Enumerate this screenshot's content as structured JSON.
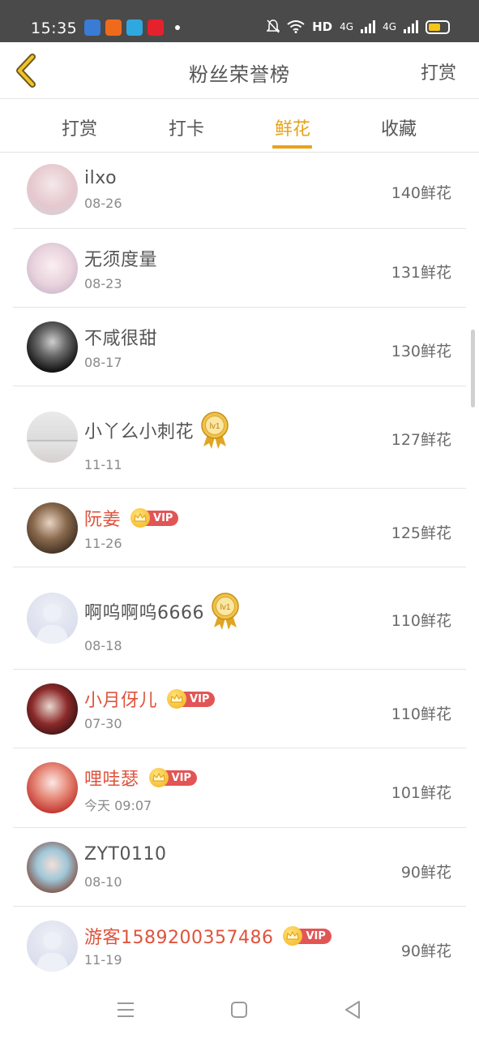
{
  "status_bar": {
    "time": "15:35",
    "network": "HD",
    "signal_labels": [
      "4G",
      "4G"
    ],
    "battery_color": "#f5c518"
  },
  "header": {
    "title": "粉丝荣誉榜",
    "right_action": "打赏",
    "back_icon": "chevron-left-icon"
  },
  "tabs": [
    {
      "label": "打赏",
      "active": false
    },
    {
      "label": "打卡",
      "active": false
    },
    {
      "label": "鲜花",
      "active": true
    },
    {
      "label": "收藏",
      "active": false
    }
  ],
  "accent_color": "#e8a21a",
  "vip_label": "VIP",
  "level_label": "lv1",
  "fans": [
    {
      "name": "ilxo",
      "date": "08-26",
      "amount": "140鲜花",
      "vip": false,
      "level": false
    },
    {
      "name": "无须度量",
      "date": "08-23",
      "amount": "131鲜花",
      "vip": false,
      "level": false
    },
    {
      "name": "不咸很甜",
      "date": "08-17",
      "amount": "130鲜花",
      "vip": false,
      "level": false
    },
    {
      "name": "小丫么小刺花",
      "date": "11-11",
      "amount": "127鲜花",
      "vip": false,
      "level": true
    },
    {
      "name": "阮姜",
      "date": "11-26",
      "amount": "125鲜花",
      "vip": true,
      "level": false
    },
    {
      "name": "啊呜啊呜6666",
      "date": "08-18",
      "amount": "110鲜花",
      "vip": false,
      "level": true
    },
    {
      "name": "小月伢儿",
      "date": "07-30",
      "amount": "110鲜花",
      "vip": true,
      "level": false
    },
    {
      "name": "哩哇瑟",
      "date": "今天 09:07",
      "amount": "101鲜花",
      "vip": true,
      "level": false
    },
    {
      "name": "ZYT0110",
      "date": "08-10",
      "amount": "90鲜花",
      "vip": false,
      "level": false
    },
    {
      "name": "游客1589200357486",
      "date": "11-19",
      "amount": "90鲜花",
      "vip": true,
      "level": false
    }
  ],
  "nav": [
    "menu-icon",
    "home-square-icon",
    "back-triangle-icon"
  ]
}
